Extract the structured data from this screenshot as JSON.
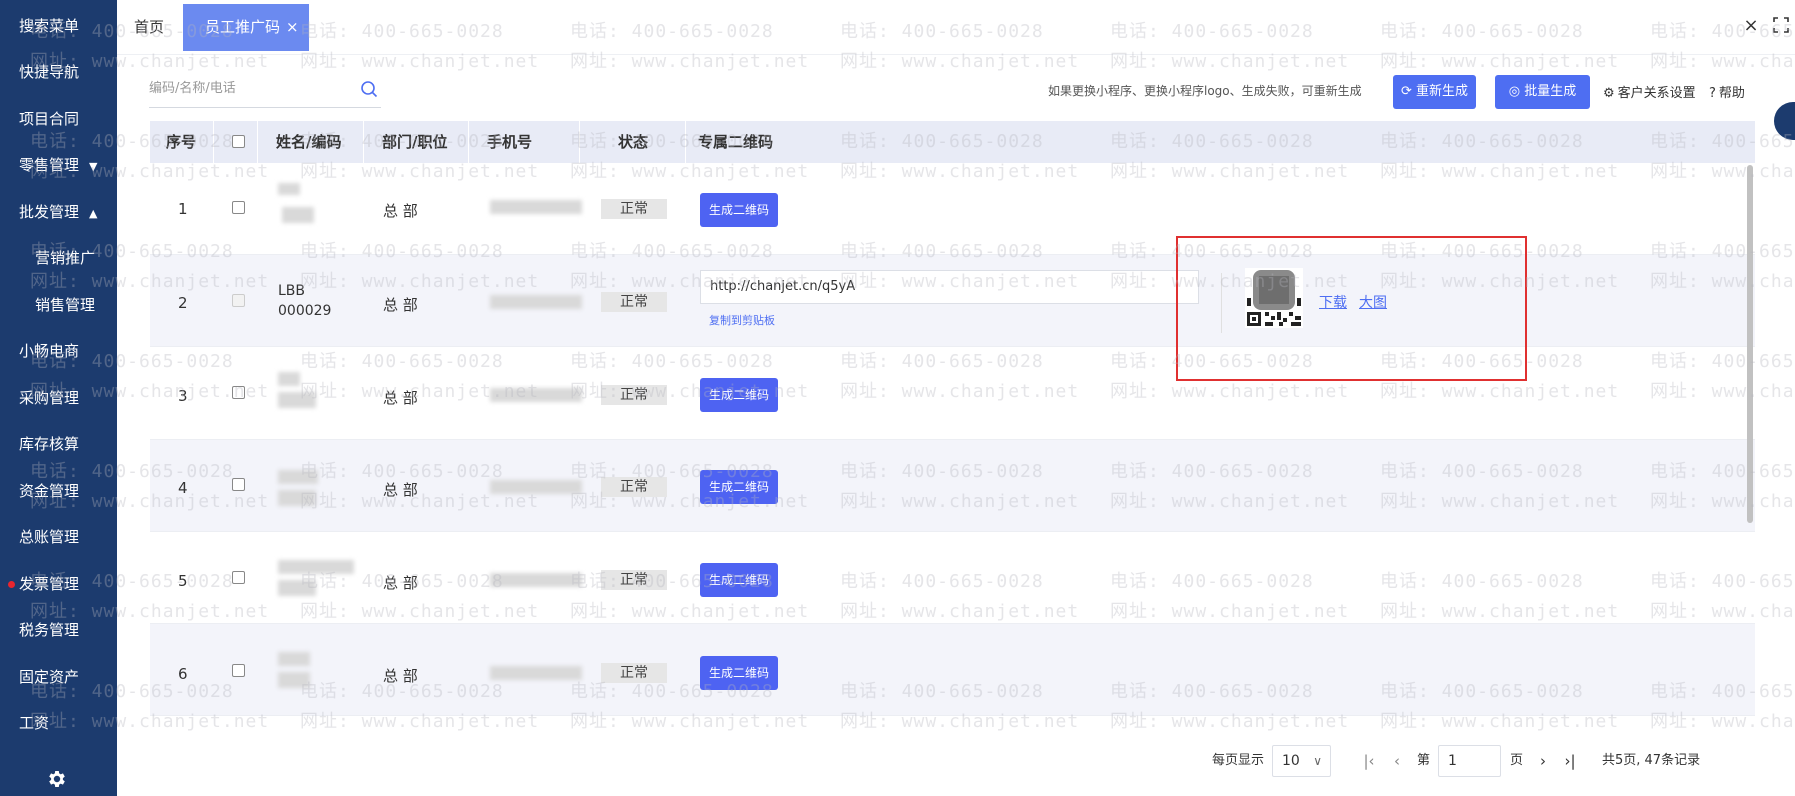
{
  "sidebar": {
    "items": [
      {
        "label": "搜索菜单",
        "sub": false,
        "caret": ""
      },
      {
        "label": "快捷导航",
        "sub": false,
        "caret": ""
      },
      {
        "label": "项目合同",
        "sub": false,
        "caret": ""
      },
      {
        "label": "零售管理",
        "sub": false,
        "caret": "▼"
      },
      {
        "label": "批发管理",
        "sub": false,
        "caret": "▲"
      },
      {
        "label": "营销推广",
        "sub": true,
        "caret": ""
      },
      {
        "label": "销售管理",
        "sub": true,
        "caret": ""
      },
      {
        "label": "小畅电商",
        "sub": false,
        "caret": ""
      },
      {
        "label": "采购管理",
        "sub": false,
        "caret": ""
      },
      {
        "label": "库存核算",
        "sub": false,
        "caret": ""
      },
      {
        "label": "资金管理",
        "sub": false,
        "caret": ""
      },
      {
        "label": "总账管理",
        "sub": false,
        "caret": ""
      },
      {
        "label": "发票管理",
        "sub": false,
        "caret": "",
        "dot": true
      },
      {
        "label": "税务管理",
        "sub": false,
        "caret": ""
      },
      {
        "label": "固定资产",
        "sub": false,
        "caret": ""
      },
      {
        "label": "工资",
        "sub": false,
        "caret": ""
      }
    ]
  },
  "tabs": {
    "home": "首页",
    "active": "员工推广码",
    "close": "×"
  },
  "window": {
    "close": "×"
  },
  "watermark": {
    "phone": "电话: 400-665-0028",
    "site": "网址: www.chanjet.net"
  },
  "search": {
    "placeholder": "编码/名称/电话",
    "value": ""
  },
  "toolbar": {
    "notice": "如果更换小程序、更换小程序logo、生成失败，可重新生成",
    "regenerate": "重新生成",
    "batch": "批量生成",
    "crm_settings": "客户关系设置",
    "help": "帮助"
  },
  "table": {
    "headers": [
      "序号",
      "",
      "姓名/编码",
      "部门/职位",
      "手机号",
      "状态",
      "专属二维码"
    ],
    "rows": [
      {
        "index": "1",
        "name": "",
        "dept": "总 部",
        "status": "正常",
        "action": "生成二维码"
      },
      {
        "index": "2",
        "name": "LBB",
        "code": "000029",
        "dept": "总 部",
        "status": "正常",
        "url": "http://chanjet.cn/q5yA",
        "copy": "复制到剪贴板",
        "download": "下载",
        "large": "大图"
      },
      {
        "index": "3",
        "name": "",
        "dept": "总 部",
        "status": "正常",
        "action": "生成二维码"
      },
      {
        "index": "4",
        "name": "",
        "dept": "总 部",
        "status": "正常",
        "action": "生成二维码"
      },
      {
        "index": "5",
        "name": "",
        "dept": "总 部",
        "status": "正常",
        "action": "生成二维码"
      },
      {
        "index": "6",
        "name": "",
        "dept": "总 部",
        "status": "正常",
        "action": "生成二维码"
      }
    ]
  },
  "pagination": {
    "per_page_label": "每页显示",
    "per_page": "10",
    "page_prefix": "第",
    "page": "1",
    "page_suffix": "页",
    "summary": "共5页, 47条记录"
  },
  "colors": {
    "sidebar": "#1c3b6e",
    "accent": "#4e6ef2",
    "highlight": "#e03030"
  },
  "icons": [
    "search-icon",
    "refresh-icon",
    "batch-icon",
    "settings-icon",
    "help-icon",
    "gear-icon",
    "close-icon",
    "fullscreen-icon"
  ]
}
